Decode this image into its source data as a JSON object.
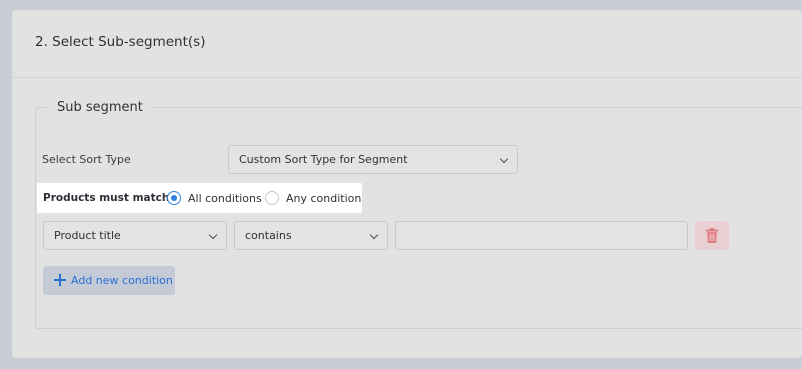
{
  "section": {
    "title": "2. Select Sub-segment(s)",
    "legend": "Sub segment"
  },
  "sort": {
    "label": "Select Sort Type",
    "selected": "Custom Sort Type for Segment"
  },
  "match": {
    "label": "Products must match :",
    "options": [
      {
        "label": "All conditions",
        "checked": true
      },
      {
        "label": "Any condition",
        "checked": false
      }
    ]
  },
  "condition": {
    "field": "Product title",
    "operator": "contains",
    "value": ""
  },
  "actions": {
    "add_label": "Add new condition",
    "delete_icon": "trash-icon",
    "add_icon": "plus-icon"
  },
  "colors": {
    "accent": "#2f7fe0",
    "delete_bg": "#e8cfd1",
    "delete_icon": "#e07a82",
    "add_bg": "#c5cbd6"
  }
}
